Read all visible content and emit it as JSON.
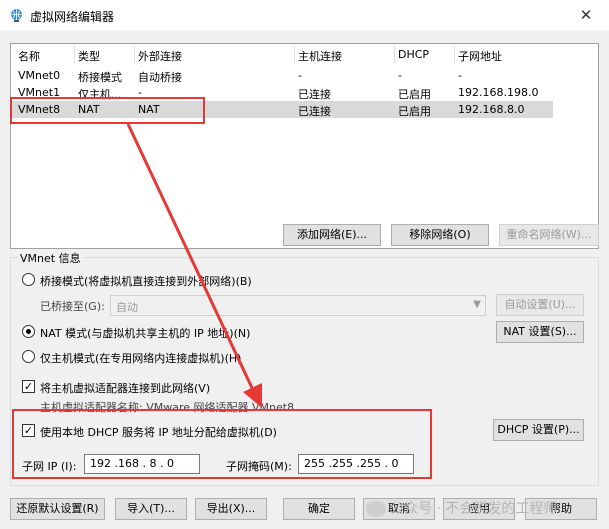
{
  "window": {
    "title": "虚拟网络编辑器",
    "close_glyph": "✕",
    "accent": "#0078d7"
  },
  "table": {
    "headers": [
      "名称",
      "类型",
      "外部连接",
      "主机连接",
      "DHCP",
      "子网地址"
    ],
    "rows": [
      [
        "VMnet0",
        "桥接模式",
        "自动桥接",
        "-",
        "-",
        "-"
      ],
      [
        "VMnet1",
        "仅主机...",
        "-",
        "已连接",
        "已启用",
        "192.168.198.0"
      ],
      [
        "VMnet8",
        "NAT",
        "NAT",
        "已连接",
        "已启用",
        "192.168.8.0"
      ]
    ],
    "selected_row": 2
  },
  "list_buttons": {
    "add": "添加网络(E)...",
    "remove": "移除网络(O)",
    "rename": "重命名网络(W)..."
  },
  "vmnet_info": {
    "title": "VMnet 信息",
    "bridge_mode": "桥接模式(将虚拟机直接连接到外部网络)(B)",
    "bridged_to_label": "已桥接至(G):",
    "bridged_to_value": "自动",
    "auto_settings": "自动设置(U)...",
    "nat_mode": "NAT 模式(与虚拟机共享主机的 IP 地址)(N)",
    "nat_settings": "NAT 设置(S)...",
    "host_only": "仅主机模式(在专用网络内连接虚拟机)(H)",
    "connect_adapter": "将主机虚拟适配器连接到此网络(V)",
    "adapter_name": "主机虚拟适配器名称: VMware 网络适配器 VMnet8",
    "use_dhcp": "使用本地 DHCP 服务将 IP 地址分配给虚拟机(D)",
    "dhcp_settings": "DHCP 设置(P)...",
    "subnet_ip_label": "子网 IP (I):",
    "subnet_ip": "192 .168 . 8 . 0",
    "subnet_mask_label": "子网掩码(M):",
    "subnet_mask": "255 .255 .255 . 0",
    "selected_mode": "nat",
    "connect_adapter_checked": true,
    "use_dhcp_checked": true
  },
  "bottom_buttons": {
    "restore": "还原默认设置(R)",
    "import": "导入(T)...",
    "export": "导出(X)...",
    "ok": "确定",
    "cancel": "取消",
    "apply": "应用",
    "help": "帮助"
  },
  "watermark": "公众号 · 不会脱发的工程师",
  "annotation_color": "#e53935"
}
